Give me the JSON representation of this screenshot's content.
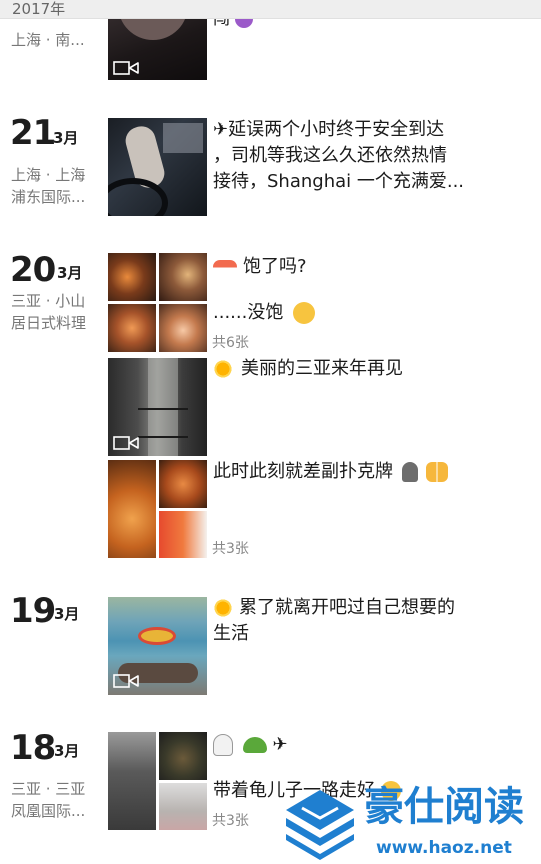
{
  "timeline": {
    "year_label": "2017年",
    "top_fragment": {
      "location": "上海 · 南...",
      "text_tail": "闯"
    },
    "entries": [
      {
        "day": "21",
        "month": "3月",
        "location_lines": [
          "上海 · 上海",
          "浦东国际..."
        ],
        "posts": [
          {
            "lines": [
              "✈延误两个小时终于安全到达",
              "，司机等我这么久还依然热情",
              "接待，Shanghai 一个充满爱..."
            ]
          }
        ]
      },
      {
        "day": "20",
        "month": "3月",
        "location_lines": [
          "三亚 · 小山",
          "居日式料理"
        ],
        "posts": [
          {
            "line1": "饱了吗?",
            "line2": "......没饱",
            "count": "共6张"
          },
          {
            "line1": "美丽的三亚来年再见"
          },
          {
            "line1": "此时此刻就差副扑克牌",
            "count": "共3张"
          }
        ]
      },
      {
        "day": "19",
        "month": "3月",
        "location_lines": [],
        "posts": [
          {
            "lines": [
              "累了就离开吧过自己想要的",
              "生活"
            ]
          }
        ]
      },
      {
        "day": "18",
        "month": "3月",
        "location_lines": [
          "三亚 · 三亚",
          "凤凰国际..."
        ],
        "posts": [
          {
            "line1": "✈",
            "line2": "带着龟儿子一路走好",
            "count": "共3张"
          }
        ]
      }
    ]
  },
  "watermark": {
    "title": "豪仕阅读",
    "url": "www.haoz.net"
  },
  "colors": {
    "text": "#1b1b1b",
    "secondary": "#777777",
    "count": "#888888",
    "year_bar": "#eeeeee",
    "watermark_blue": "#1f7fd0"
  },
  "icons": [
    "video-icon",
    "sushi-emoji",
    "flushed-face-emoji",
    "sun-emoji",
    "couple-emoji",
    "ghost-emoji",
    "turtle-emoji",
    "grin-emoji"
  ]
}
